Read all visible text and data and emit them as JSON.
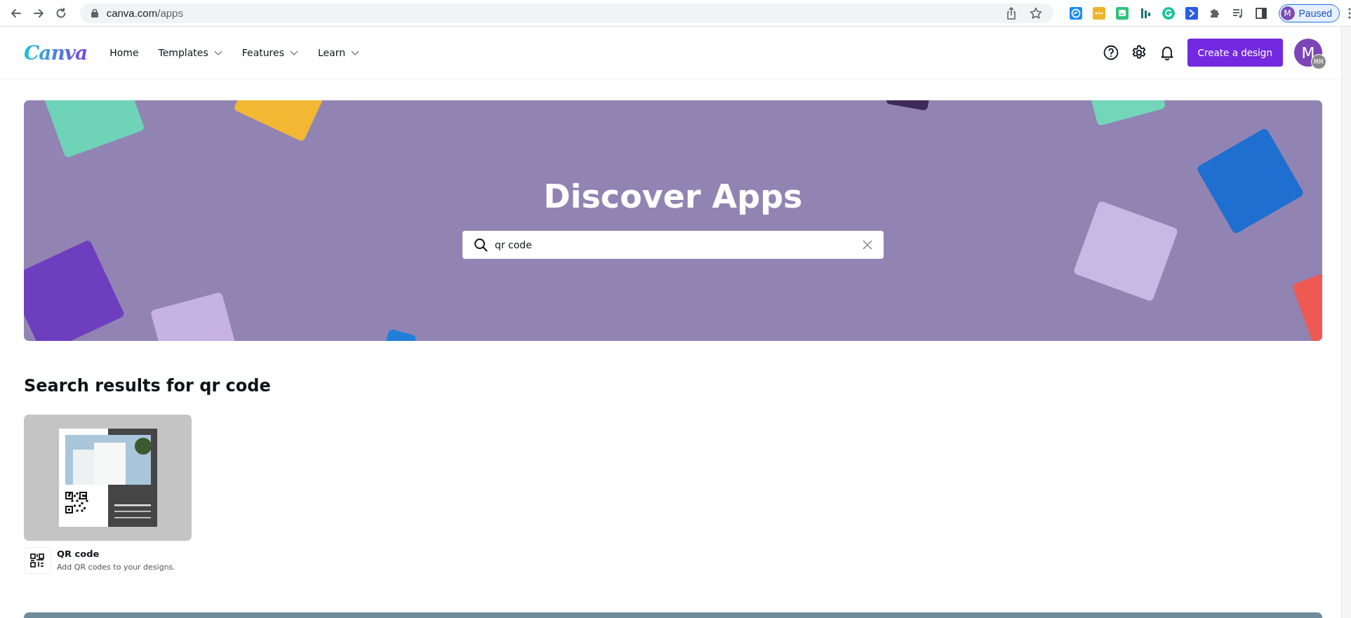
{
  "browser": {
    "url_host": "canva.com",
    "url_path": "/apps",
    "profile": {
      "initial": "M",
      "status": "Paused"
    }
  },
  "nav": {
    "logo": "Canva",
    "items": [
      {
        "label": "Home",
        "dropdown": false
      },
      {
        "label": "Templates",
        "dropdown": true
      },
      {
        "label": "Features",
        "dropdown": true
      },
      {
        "label": "Learn",
        "dropdown": true
      }
    ],
    "create_button": "Create a design",
    "avatar": {
      "initial": "M",
      "badge": "MM"
    }
  },
  "hero": {
    "title": "Discover Apps",
    "search": {
      "value": "qr code"
    }
  },
  "results": {
    "heading": "Search results for qr code",
    "apps": [
      {
        "title": "QR code",
        "description": "Add QR codes to your designs."
      }
    ]
  }
}
